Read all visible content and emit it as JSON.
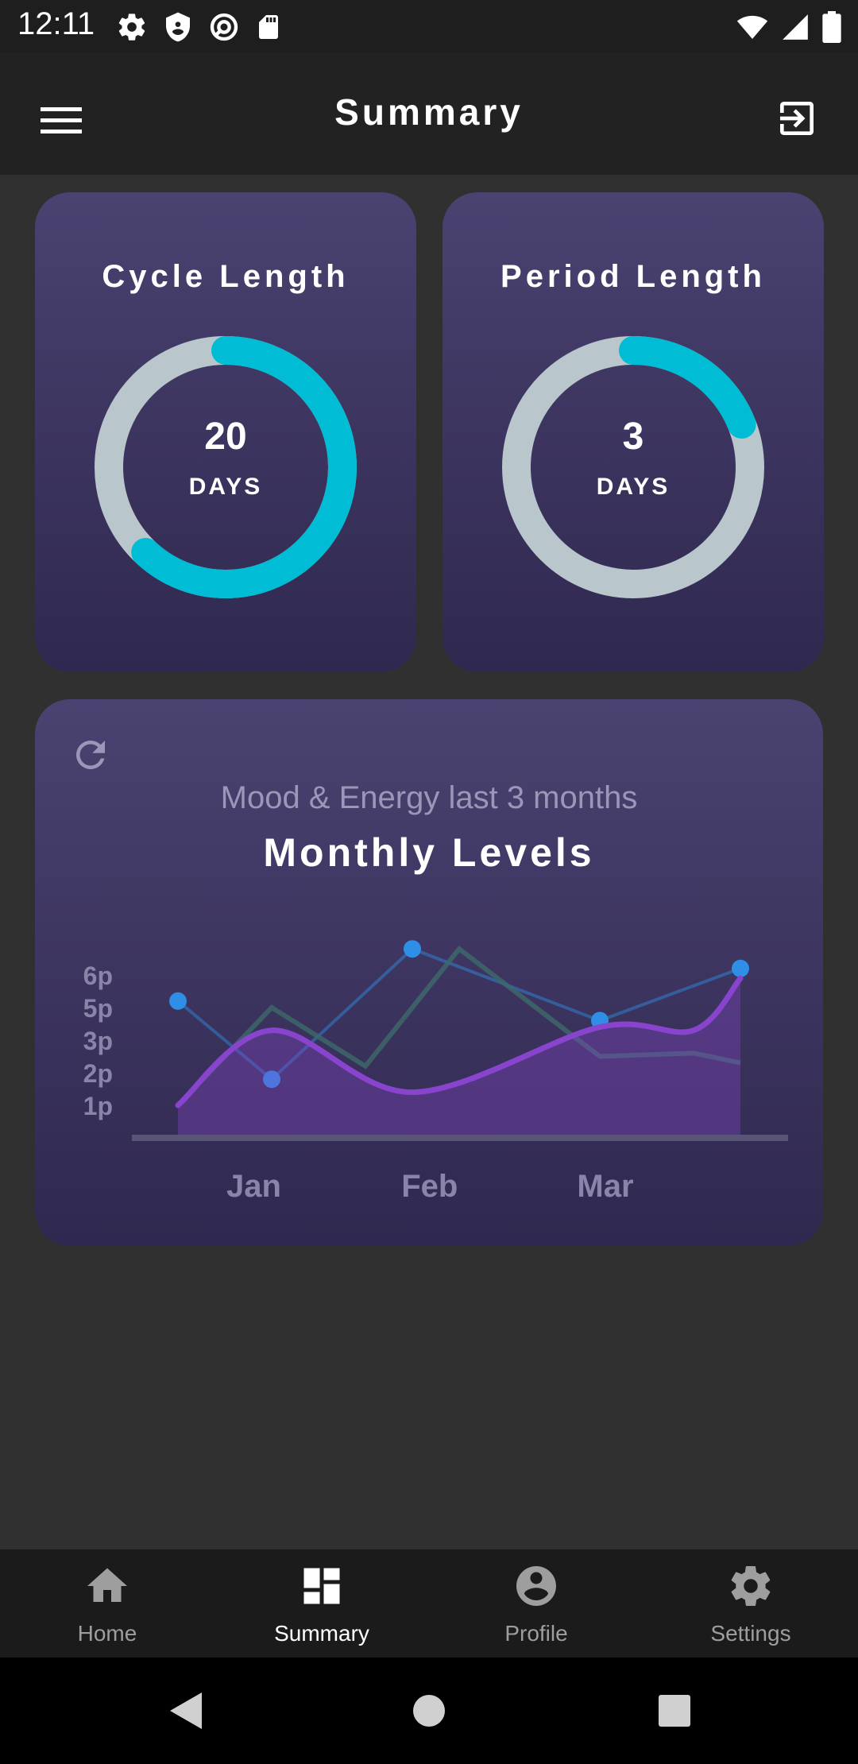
{
  "status_bar": {
    "time": "12:11"
  },
  "app_bar": {
    "title": "Summary"
  },
  "cycle_card": {
    "title": "Cycle Length",
    "value": "20",
    "unit": "DAYS",
    "progress": 0.62
  },
  "period_card": {
    "title": "Period Length",
    "value": "3",
    "unit": "DAYS",
    "progress": 0.19
  },
  "chart_card": {
    "subtitle": "Mood & Energy last 3 months",
    "title": "Monthly Levels"
  },
  "chart_data": {
    "type": "line",
    "title": "Monthly Levels",
    "subtitle": "Mood & Energy last 3 months",
    "x_labels": [
      "Jan",
      "Feb",
      "Mar"
    ],
    "y_ticks": [
      "1p",
      "2p",
      "3p",
      "5p",
      "6p"
    ],
    "ylim": [
      0,
      6
    ],
    "series": [
      {
        "kind": "points",
        "color": "#2f8fe6",
        "x": [
          0,
          0.4,
          1.0,
          1.8,
          2.4
        ],
        "y": [
          4.2,
          1.8,
          5.8,
          3.6,
          5.2
        ]
      },
      {
        "kind": "line",
        "color": "#3d6a6a",
        "x": [
          0,
          0.4,
          0.8,
          1.2,
          1.8,
          2.2,
          2.4
        ],
        "y": [
          1.0,
          4.0,
          2.2,
          5.8,
          2.5,
          2.6,
          2.3
        ]
      },
      {
        "kind": "area",
        "color": "#8844cc",
        "x": [
          0,
          0.4,
          1.0,
          1.8,
          2.2,
          2.4
        ],
        "y": [
          1.0,
          3.3,
          1.4,
          3.4,
          3.3,
          4.9
        ]
      }
    ],
    "grid": false,
    "legend": "none"
  },
  "bottom_nav": {
    "items": [
      {
        "label": "Home",
        "icon": "home-icon"
      },
      {
        "label": "Summary",
        "icon": "dashboard-icon",
        "active": true
      },
      {
        "label": "Profile",
        "icon": "profile-icon"
      },
      {
        "label": "Settings",
        "icon": "settings-icon"
      }
    ]
  },
  "colors": {
    "accent": "#00bcd4",
    "ring_track": "#b9c6cc",
    "card_top": "#4a4270",
    "card_bottom": "#2f284f",
    "line_purple": "#8844cc",
    "point_blue": "#2f8fe6"
  }
}
